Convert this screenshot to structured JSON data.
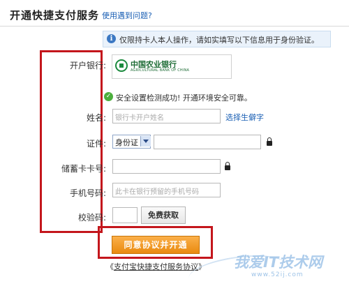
{
  "header": {
    "title": "开通快捷支付服务",
    "help_link": "使用遇到问题?"
  },
  "notice": {
    "icon": "info-icon",
    "text": "仅限持卡人本人操作，请如实填写以下信息用于身份验证。"
  },
  "bank": {
    "label": "开户银行:",
    "name_cn": "中国农业银行",
    "name_en": "AGRICULTURAL BANK OF CHINA"
  },
  "security": {
    "icon": "check-icon",
    "text": "安全设置检测成功! 开通环境安全可靠。"
  },
  "form": {
    "name": {
      "label": "姓名:",
      "placeholder": "银行卡开户姓名",
      "rare_char_link": "选择生僻字"
    },
    "id": {
      "label": "证件:",
      "type": "身份证",
      "value": ""
    },
    "card": {
      "label": "储蓄卡卡号:",
      "value": ""
    },
    "phone": {
      "label": "手机号码:",
      "placeholder": "此卡在银行预留的手机号码"
    },
    "code": {
      "label": "校验码:",
      "value": "",
      "get_button": "免费获取"
    }
  },
  "submit": {
    "label": "同意协议并开通"
  },
  "protocol": {
    "open": "《",
    "text": "支付宝快捷支付服务协议",
    "close": "》"
  },
  "watermark": {
    "text": "我爱IT技术网",
    "url": "www.52ij.com"
  },
  "colors": {
    "highlight": "#c4161c",
    "link": "#1a5fb4",
    "button": "#e98a0f"
  }
}
